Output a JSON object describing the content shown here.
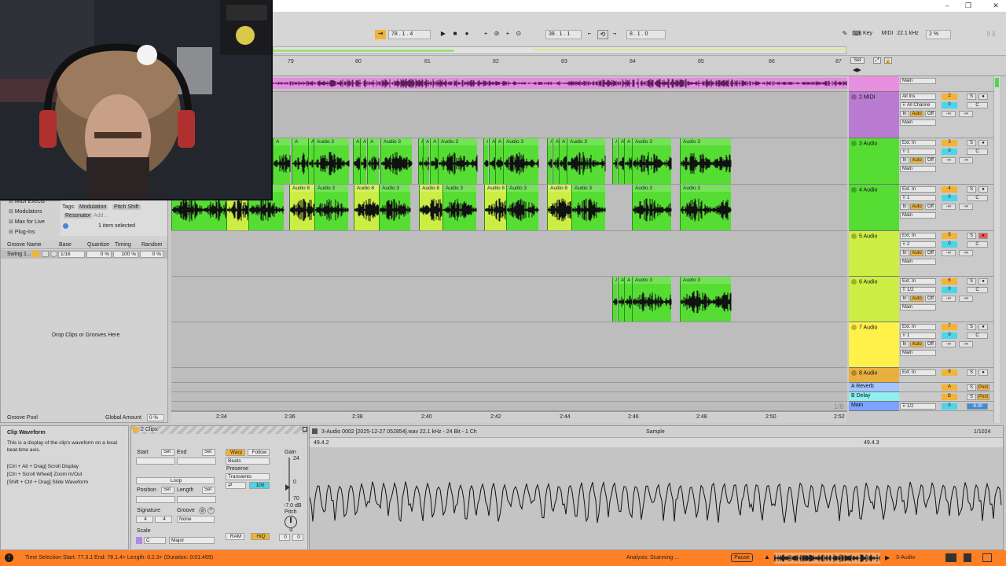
{
  "window": {
    "minimize": "–",
    "restore": "❐",
    "close": "✕"
  },
  "transport": {
    "follow_icon": "follow-arrow-icon",
    "arrangement_position": "78 .  1 .  4",
    "loop_start": "38 .  1 .  1",
    "loop_length": "8 .  1 .  0",
    "key_label": "Key",
    "midi_label": "MIDI",
    "sample_rate": "22.1 kHz",
    "cpu_load": "2 %"
  },
  "ruler": {
    "bars": [
      "79",
      "80",
      "81",
      "82",
      "83",
      "84",
      "85",
      "86",
      "87"
    ],
    "set_label": "Set"
  },
  "time_ruler": {
    "labels": [
      "2:34",
      "2:36",
      "2:38",
      "2:40",
      "2:42",
      "2:44",
      "2:46",
      "2:48",
      "2:50",
      "2:52"
    ],
    "zoom": "1/8"
  },
  "tracks": [
    {
      "name": "",
      "color": "#e88fe0",
      "input": "Main",
      "num": "",
      "vol": ""
    },
    {
      "name": "2 MIDI",
      "color": "#b97bd1",
      "input": "All Ins",
      "channel": "All Channe",
      "num": "2",
      "vol": "0",
      "mon_in": "In",
      "mon_auto": "Auto",
      "mon_off": "Off",
      "out": "Main",
      "send": "-∞"
    },
    {
      "name": "3 Audio",
      "color": "#55dd33",
      "input": "Ext. In",
      "channel": "1",
      "num": "3",
      "vol": "0",
      "mon_in": "In",
      "mon_auto": "Auto",
      "mon_off": "Off",
      "out": "Main",
      "send": "-∞"
    },
    {
      "name": "4 Audio",
      "color": "#55dd33",
      "input": "Ext. In",
      "channel": "1",
      "num": "4",
      "vol": "0",
      "mon_in": "In",
      "mon_auto": "Auto",
      "mon_off": "Off",
      "out": "Main",
      "send": "-∞"
    },
    {
      "name": "5 Audio",
      "color": "#ccee44",
      "input": "Ext. In",
      "channel": "2",
      "num": "5",
      "vol": "0",
      "mon_in": "In",
      "mon_auto": "Auto",
      "mon_off": "Off",
      "out": "Main",
      "send": "-∞"
    },
    {
      "name": "6 Audio",
      "color": "#ccee44",
      "input": "Ext. In",
      "channel": "1/2",
      "num": "6",
      "vol": "0",
      "mon_in": "In",
      "mon_auto": "Auto",
      "mon_off": "Off",
      "out": "Main",
      "send": "-∞"
    },
    {
      "name": "7 Audio",
      "color": "#fff04a",
      "input": "Ext. In",
      "channel": "1",
      "num": "7",
      "vol": "0",
      "mon_in": "In",
      "mon_auto": "Auto",
      "mon_off": "Off",
      "out": "Main",
      "send": "-∞"
    },
    {
      "name": "8 Audio",
      "color": "#e8b040",
      "input": "Ext. In",
      "num": "8",
      "vol": "0"
    }
  ],
  "returns": [
    {
      "name": "A Reverb",
      "color": "#a3c4ff",
      "letter": "A",
      "post": "Post"
    },
    {
      "name": "B Delay",
      "color": "#8ff0f0",
      "letter": "B",
      "post": "Post"
    },
    {
      "name": "Main",
      "color": "#7da2ff",
      "channel": "1/2",
      "num": "0",
      "vol": "-6.00"
    }
  ],
  "clips": {
    "audio3": "Audio 3",
    "audio8": "Audio 8",
    "a": "A"
  },
  "browser": {
    "items": [
      "MIDI Effects",
      "Modulators",
      "Max for Live",
      "Plug-Ins"
    ],
    "tags_label": "Tags:",
    "tags": [
      "Modulation",
      "Pitch Shift",
      "Resonator",
      "Add..."
    ],
    "selected": "1 item selected"
  },
  "groove": {
    "headers": [
      "Groove Name",
      "Base",
      "Quantize",
      "Timing",
      "Random"
    ],
    "row": {
      "name": "Swing 1...",
      "base": "1/16",
      "quantize": "0 %",
      "timing": "100 %",
      "random": "0 %"
    },
    "drop_text": "Drop Clips or Grooves Here",
    "pool_label": "Groove Pool",
    "global_amount_label": "Global Amount",
    "global_amount": "0 %"
  },
  "info": {
    "title": "Clip Waveform",
    "lines": [
      "This is a display of the clip's waveform on a local beat-time axis.",
      "[Ctrl + Alt + Drag] Scroll Display",
      "[Ctrl + Scroll Wheel] Zoom In/Out",
      "[Shift + Ctrl + Drag] Slide Waveform"
    ]
  },
  "clipview": {
    "header": "2 Clips",
    "start": "Start",
    "end": "End",
    "set": "Set",
    "loop": "Loop",
    "position": "Position",
    "length": "Length",
    "signature": "Signature",
    "sig_num": "4",
    "sig_den": "4",
    "groove": "Groove",
    "groove_val": "None",
    "scale": "Scale",
    "scale_root": "C",
    "scale_name": "Major",
    "warp": "Warp",
    "follow": "Follow",
    "beats": "Beats",
    "preserve": "Preserve",
    "transients": "Transients",
    "amount": "100",
    "gain": "Gain",
    "gain_top": "24",
    "gain_mid": "0",
    "gain_bot": "70",
    "gain_db": "-7.0 dB",
    "pitch": "Pitch",
    "st": "st",
    "pitch_a": "0",
    "pitch_b": "0",
    "ram": "RAM",
    "hiq": "HiQ",
    "file": "3-Audio 0002 [2025-12-27 052854].wav  22.1 kHz - 24 Bit - 1 Ch",
    "sample_tab": "Sample",
    "zoom": "1/1024",
    "marker1": "49.4.2",
    "marker2": "49.4.3"
  },
  "status": {
    "left": "Time Selection  Start: 77.3.1  End: 78.1.4+  Length: 0.2.3+ (Duration: 0:01:469)",
    "analysis": "Analysis: Scanning ...",
    "pause": "Pause",
    "track": "3-Audio"
  },
  "colors": {
    "accent": "#ff7f24",
    "clip_green": "#55dd33",
    "clip_yellow": "#ccee44",
    "midi_pink": "#d770d6"
  }
}
